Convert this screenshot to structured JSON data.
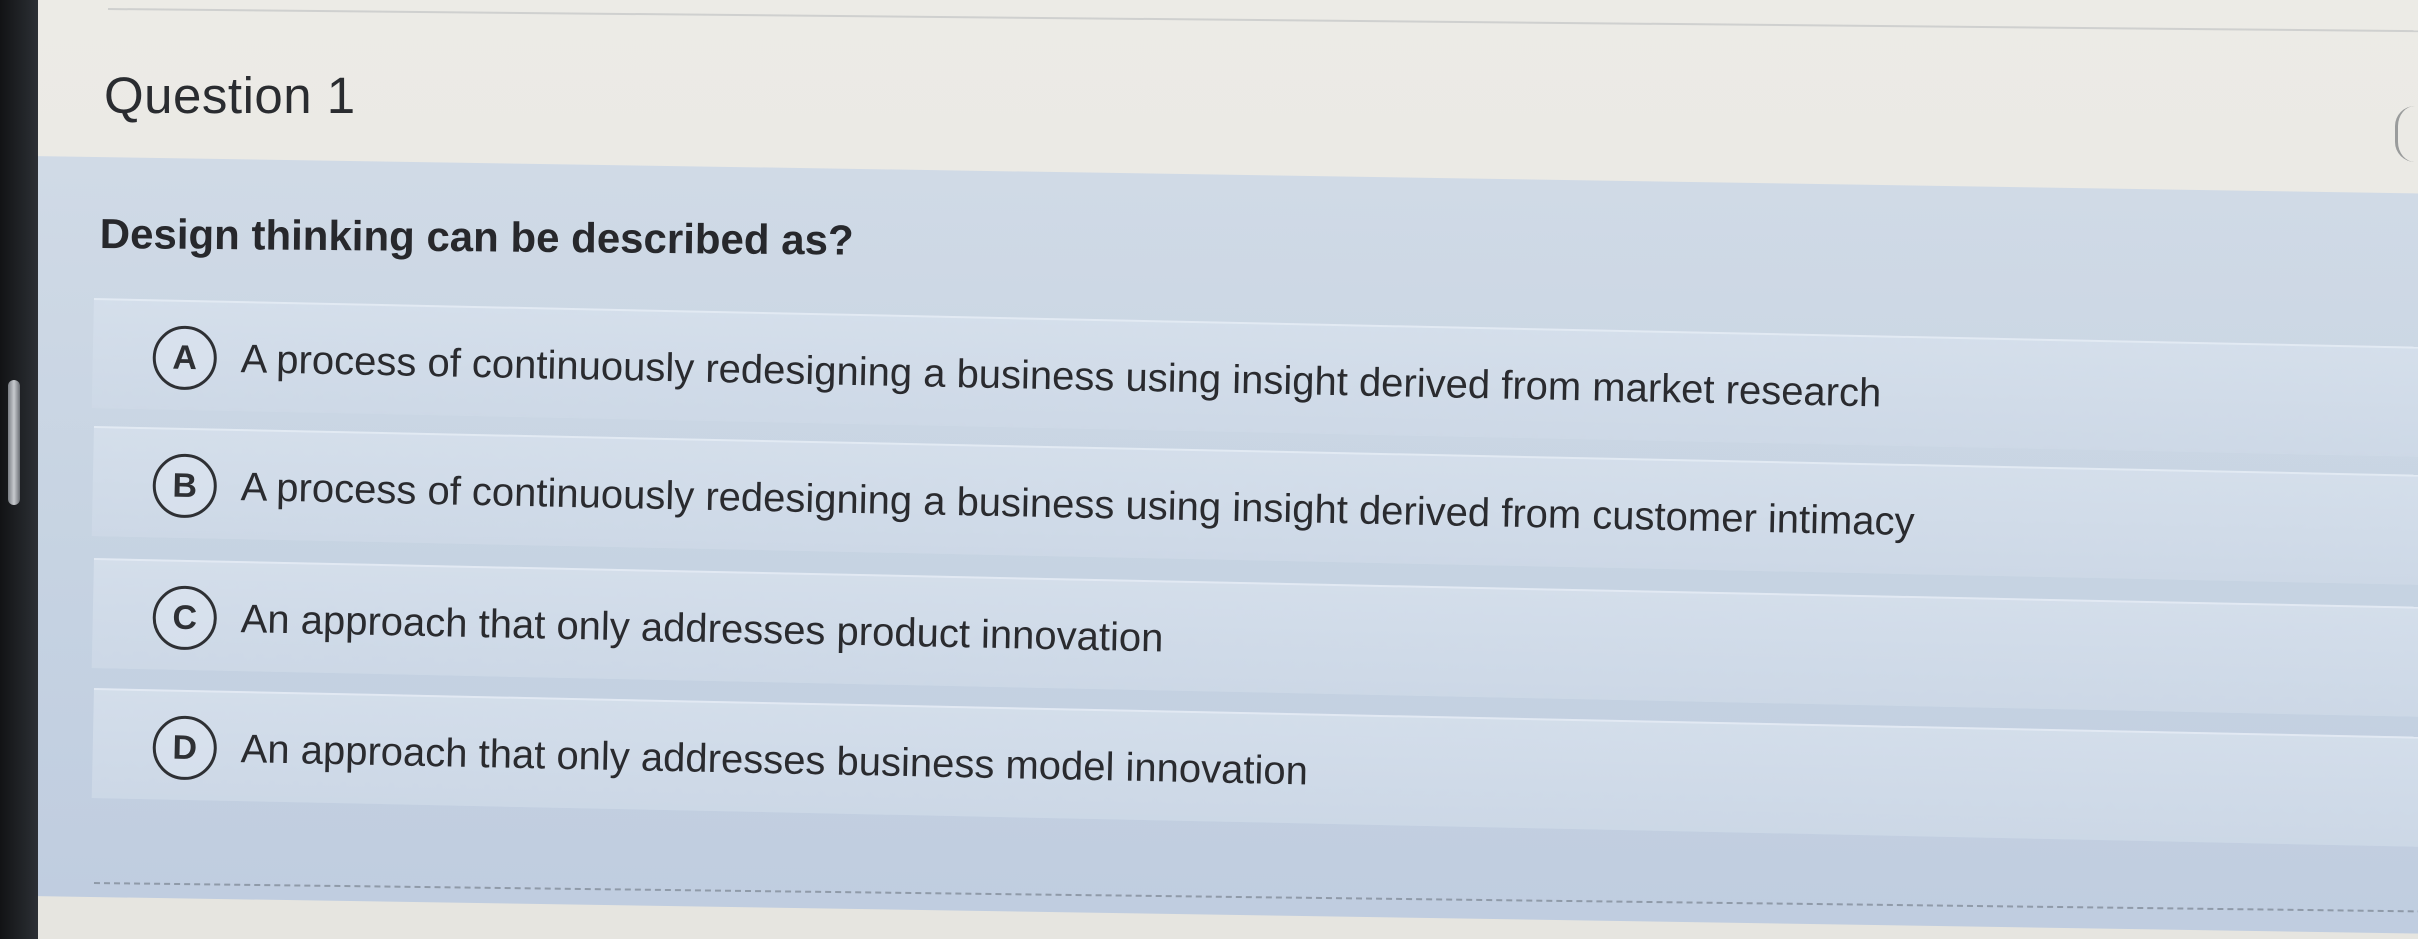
{
  "question": {
    "title": "Question 1",
    "prompt": "Design thinking can be described as?"
  },
  "options": [
    {
      "letter": "A",
      "text": "A process of continuously redesigning a business using insight derived from market research"
    },
    {
      "letter": "B",
      "text": "A process of continuously redesigning a business using insight derived from customer intimacy"
    },
    {
      "letter": "C",
      "text": "An approach that only addresses product innovation"
    },
    {
      "letter": "D",
      "text": "An approach that only addresses business model innovation"
    }
  ]
}
